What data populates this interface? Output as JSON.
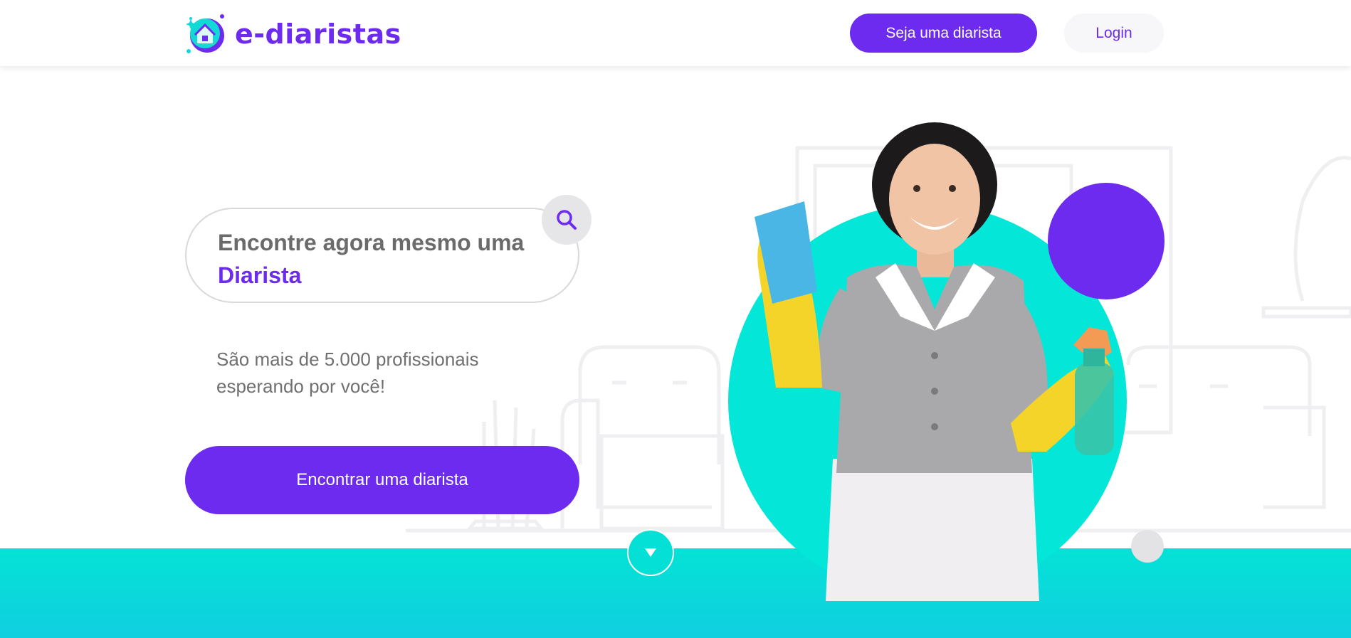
{
  "header": {
    "brand": "e-diaristas",
    "signup_label": "Seja uma diarista",
    "login_label": "Login"
  },
  "hero": {
    "search_line1": "Encontre agora mesmo uma",
    "search_line2": "Diarista",
    "subtitle": "São mais de 5.000 profissionais esperando por você!",
    "cta_label": "Encontrar uma diarista"
  },
  "colors": {
    "brand_purple": "#6c2bef",
    "teal": "#04e6d8",
    "text_grey": "#6b6b6b"
  },
  "icons": {
    "search": "search-icon",
    "scroll": "arrow-down-icon",
    "logo": "house-logo-icon"
  }
}
